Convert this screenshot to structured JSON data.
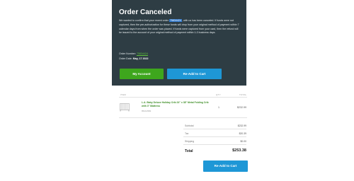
{
  "hero": {
    "title": "Order Canceled",
    "message_before": "We wanted to confirm that your recent order ",
    "order_highlight": "75834424",
    "message_after": ", with us has been canceled. If funds were not captured, then the pre-authorization for these funds will drop from your original method of payment within 7 calendar days from when the order was placed. If funds were captured from your card, then the refund will be issued to the account of your original method of payment within 1-3 business days.",
    "order_number_label": "Order Number:",
    "order_number": "75834424",
    "order_date_label": "Order Date:",
    "order_date": "May, 17 2022",
    "my_account_label": "My Account",
    "readd_label": "Re-Add to Cart"
  },
  "table": {
    "headers": {
      "item": "ITEM",
      "qty": "QTY",
      "total": "TOTAL"
    },
    "items": [
      {
        "name": "L.A. Baby Deluxe Holiday Crib 24\" x 38\" Metal Folding Crib with 3\" Mattress",
        "sku": "85212582",
        "qty": "1",
        "price": "$232.99"
      }
    ]
  },
  "summary": {
    "subtotal_label": "Subtotal",
    "subtotal": "$232.99",
    "tax_label": "Tax",
    "tax": "$20.39",
    "shipping_label": "Shipping",
    "shipping": "$0.00",
    "total_label": "Total",
    "total": "$253.38"
  },
  "footer": {
    "readd_label": "Re-Add to Cart"
  },
  "colors": {
    "hero_bg": "#2e3d44",
    "account_button": "#3ea61d",
    "readd_button": "#1e97d6",
    "highlight": "#2b74c9",
    "link_green": "#5fc13b"
  }
}
